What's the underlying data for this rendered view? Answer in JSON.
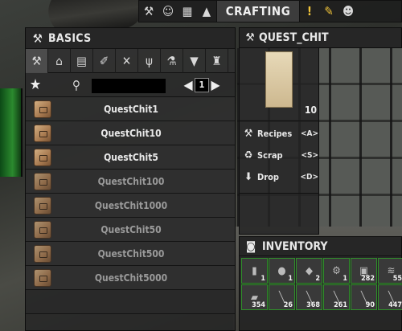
{
  "topbar": {
    "title": "CRAFTING",
    "icons": [
      "hammer-icon",
      "character-icon",
      "map-icon",
      "graduation-cap-icon",
      "exclamation-icon",
      "pencil-icon",
      "people-icon"
    ]
  },
  "basics": {
    "title": "BASICS",
    "categories": [
      "hammer",
      "house",
      "bricks",
      "syringe",
      "tools",
      "fork",
      "flask",
      "shirt",
      "chair"
    ],
    "search": {
      "value": "",
      "placeholder": ""
    },
    "page": "1",
    "recipes": [
      {
        "name": "QuestChit1",
        "locked": false
      },
      {
        "name": "QuestChit10",
        "locked": false
      },
      {
        "name": "QuestChit5",
        "locked": false
      },
      {
        "name": "QuestChit100",
        "locked": true
      },
      {
        "name": "QuestChit1000",
        "locked": true
      },
      {
        "name": "QuestChit50",
        "locked": true
      },
      {
        "name": "QuestChit500",
        "locked": true
      },
      {
        "name": "QuestChit5000",
        "locked": true
      }
    ]
  },
  "item": {
    "title": "QUEST_CHIT",
    "count": "10",
    "actions": [
      {
        "label": "Recipes",
        "key": "<A>",
        "icon": "hammer-icon"
      },
      {
        "label": "Scrap",
        "key": "<S>",
        "icon": "recycle-icon"
      },
      {
        "label": "Drop",
        "key": "<D>",
        "icon": "arrow-down-icon"
      }
    ]
  },
  "inventory": {
    "title": "INVENTORY",
    "slots": [
      {
        "count": "1",
        "icon": "can-icon"
      },
      {
        "count": "1",
        "icon": "pot-icon"
      },
      {
        "count": "2",
        "icon": "rock-icon"
      },
      {
        "count": "1",
        "icon": "engine-icon"
      },
      {
        "count": "282",
        "icon": "box-icon"
      },
      {
        "count": "55",
        "icon": "wire-icon"
      },
      {
        "count": "354",
        "icon": "resource-icon"
      },
      {
        "count": "26",
        "icon": "bullet-icon"
      },
      {
        "count": "368",
        "icon": "bullet-icon"
      },
      {
        "count": "261",
        "icon": "bullet-icon"
      },
      {
        "count": "90",
        "icon": "bullet-icon"
      },
      {
        "count": "447",
        "icon": "bullet-icon"
      }
    ]
  }
}
